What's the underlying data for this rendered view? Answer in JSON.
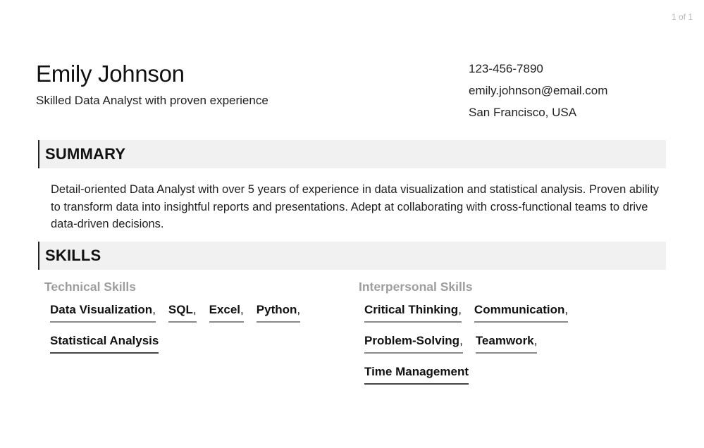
{
  "page_counter": "1 of 1",
  "header": {
    "name": "Emily Johnson",
    "tagline": "Skilled Data Analyst with proven experience",
    "contact": {
      "phone": "123-456-7890",
      "email": "emily.johnson@email.com",
      "location": "San Francisco, USA"
    }
  },
  "summary": {
    "title": "SUMMARY",
    "text": "Detail-oriented Data Analyst with over 5 years of experience in data visualization and statistical analysis. Proven ability to transform data into insightful reports and presentations. Adept at collaborating with cross-functional teams to drive data-driven decisions."
  },
  "skills": {
    "title": "SKILLS",
    "technical": {
      "heading": "Technical Skills",
      "items": [
        "Data Visualization",
        "SQL",
        "Excel",
        "Python",
        "Statistical Analysis"
      ]
    },
    "interpersonal": {
      "heading": "Interpersonal Skills",
      "items": [
        "Critical Thinking",
        "Communication",
        "Problem-Solving",
        "Teamwork",
        "Time Management"
      ]
    }
  }
}
